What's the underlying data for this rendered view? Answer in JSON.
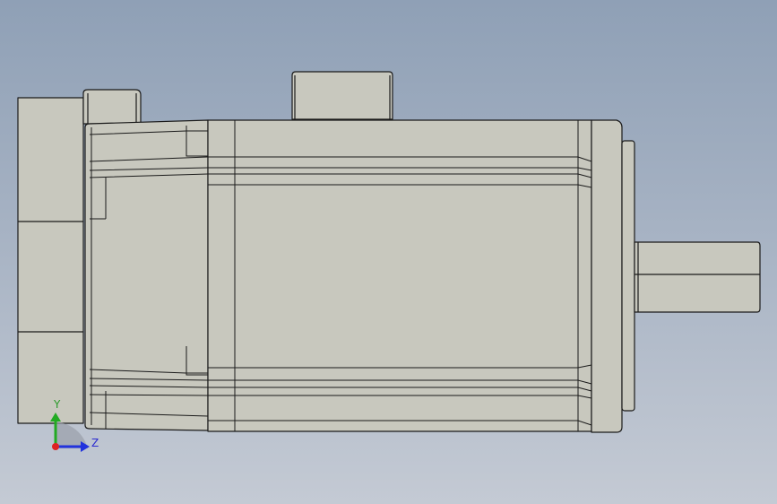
{
  "viewport": {
    "view_type": "3D model viewport",
    "background": [
      "#8fa0b6",
      "#c4cad4"
    ]
  },
  "model": {
    "part_type": "servo motor",
    "body_color": "#c8c8be",
    "edge_color": "#1a1a1a"
  },
  "triad": {
    "y_label": "Y",
    "z_label": "Z",
    "y_color": "#22aa22",
    "z_color": "#2233dd",
    "x_color": "#dd2222"
  }
}
